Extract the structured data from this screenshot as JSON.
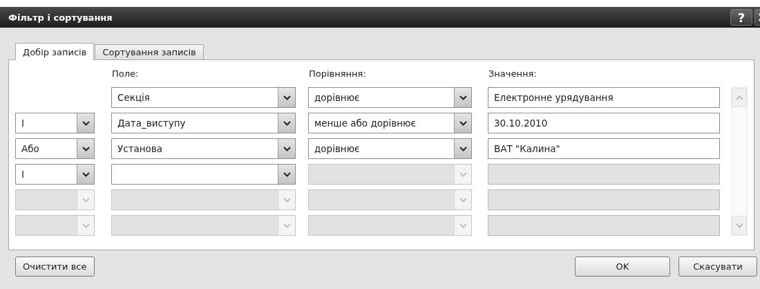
{
  "window": {
    "title": "Фільтр і сортування",
    "help_label": "?"
  },
  "tabs": [
    {
      "label": "Добір записів",
      "selected": true
    },
    {
      "label": "Сортування записів",
      "selected": false
    }
  ],
  "columns": [
    "Поле:",
    "Порівняння:",
    "Значення:"
  ],
  "rows": [
    {
      "cells": [
        {
          "kind": "none"
        },
        {
          "kind": "dropdown",
          "value": "Секція",
          "disabled": false
        },
        {
          "kind": "dropdown",
          "value": "дорівнює",
          "disabled": false
        },
        {
          "kind": "text",
          "value": "Електронне урядування",
          "disabled": false
        }
      ]
    },
    {
      "cells": [
        {
          "kind": "dropdown",
          "value": "I",
          "disabled": false
        },
        {
          "kind": "dropdown",
          "value": "Дата_виступу",
          "disabled": false
        },
        {
          "kind": "dropdown",
          "value": "менше або дорівнює",
          "disabled": false
        },
        {
          "kind": "text",
          "value": "30.10.2010",
          "disabled": false
        }
      ]
    },
    {
      "cells": [
        {
          "kind": "dropdown",
          "value": "Або",
          "disabled": false
        },
        {
          "kind": "dropdown",
          "value": "Установа",
          "disabled": false
        },
        {
          "kind": "dropdown",
          "value": "дорівнює",
          "disabled": false
        },
        {
          "kind": "text",
          "value": "ВАТ \"Калина\"",
          "disabled": false
        }
      ]
    },
    {
      "cells": [
        {
          "kind": "dropdown",
          "value": "I",
          "disabled": false
        },
        {
          "kind": "dropdown",
          "disabled": false
        },
        {
          "kind": "dropdown",
          "disabled": true
        },
        {
          "kind": "text",
          "disabled": true
        }
      ]
    },
    {
      "cells": [
        {
          "kind": "dropdown",
          "disabled": true
        },
        {
          "kind": "dropdown",
          "disabled": true
        },
        {
          "kind": "dropdown",
          "disabled": true
        },
        {
          "kind": "text",
          "disabled": true
        }
      ]
    },
    {
      "cells": [
        {
          "kind": "dropdown",
          "disabled": true
        },
        {
          "kind": "dropdown",
          "disabled": true
        },
        {
          "kind": "dropdown",
          "disabled": true
        },
        {
          "kind": "text",
          "disabled": true
        }
      ]
    }
  ],
  "left_buttons": [
    "Очистити все"
  ],
  "right_buttons": [
    "OK",
    "Скасувати"
  ]
}
